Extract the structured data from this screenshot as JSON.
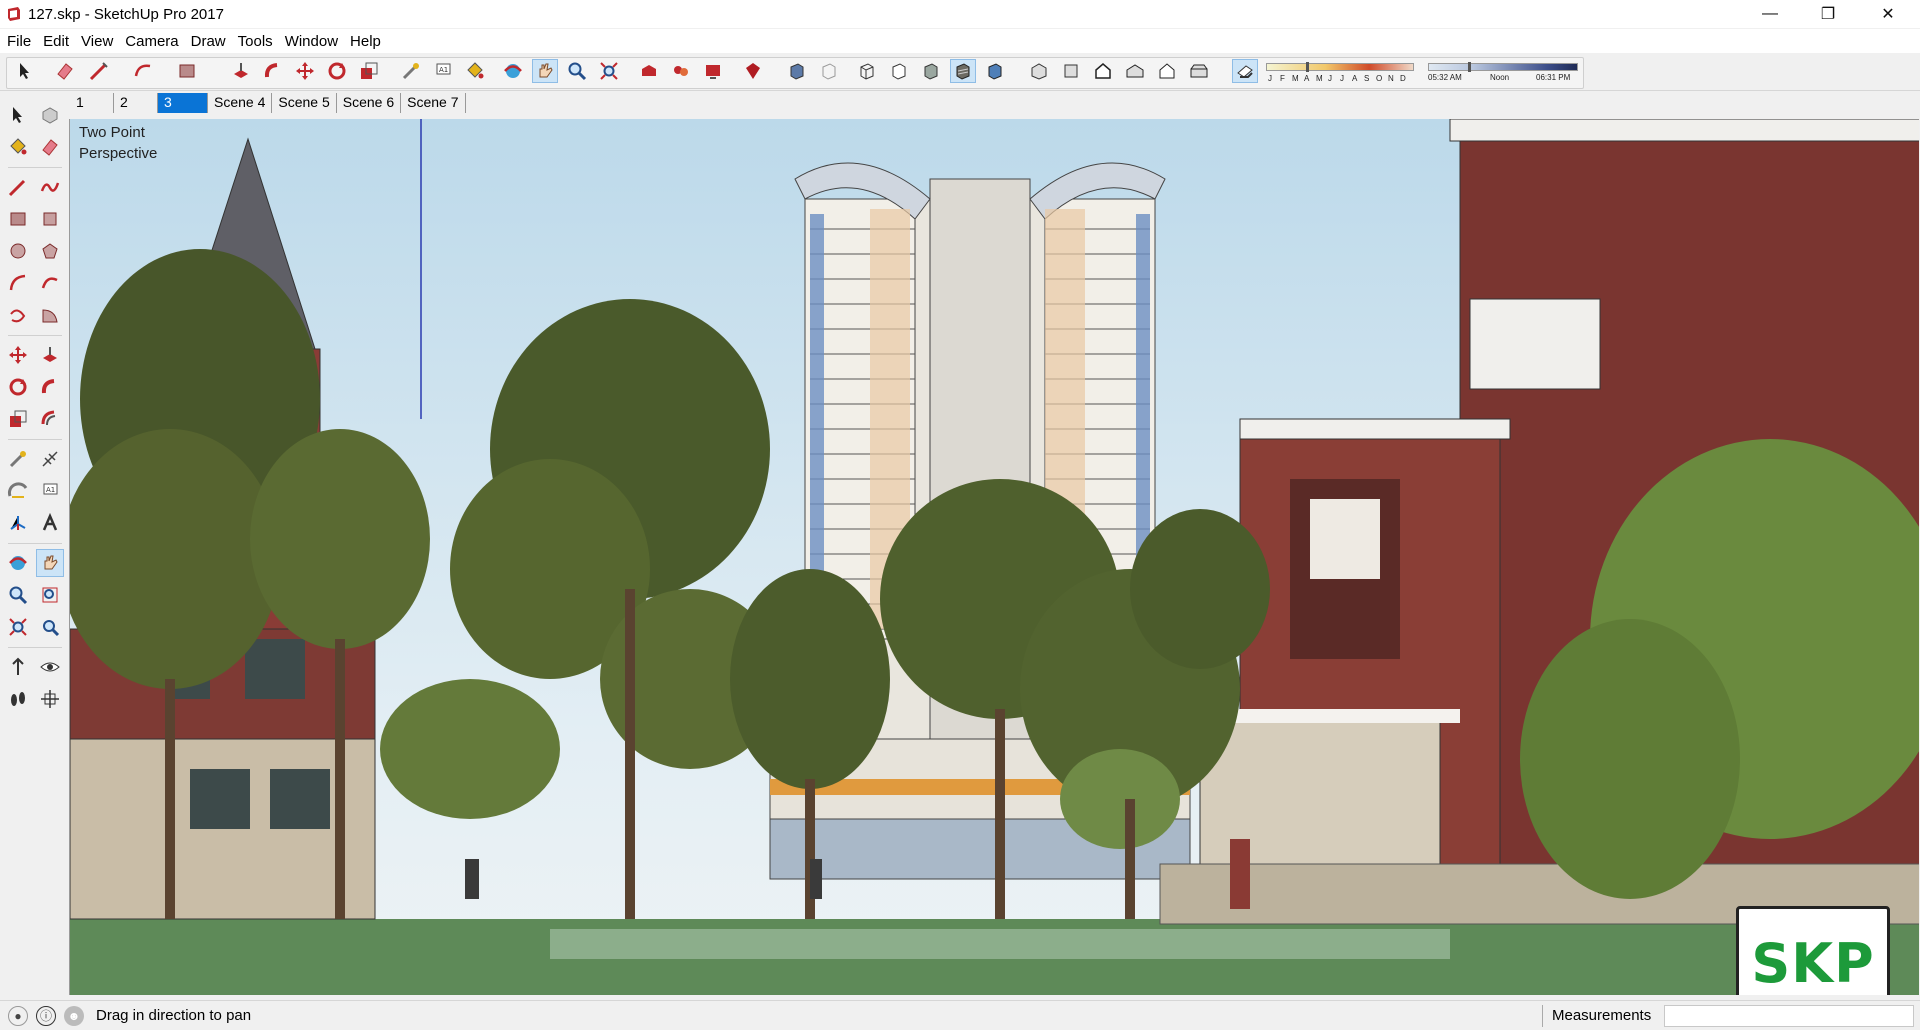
{
  "window": {
    "title": "127.skp - SketchUp Pro 2017",
    "minimize_glyph": "—",
    "maximize_glyph": "❐",
    "close_glyph": "✕"
  },
  "menu": [
    "File",
    "Edit",
    "View",
    "Camera",
    "Draw",
    "Tools",
    "Window",
    "Help"
  ],
  "toolbar": {
    "shadow_months": [
      "J",
      "F",
      "M",
      "A",
      "M",
      "J",
      "J",
      "A",
      "S",
      "O",
      "N",
      "D"
    ],
    "time_start": "05:32 AM",
    "time_mid": "Noon",
    "time_end": "06:31 PM"
  },
  "scenes": {
    "tabs": [
      "1",
      "2",
      "3",
      "Scene 4",
      "Scene 5",
      "Scene 6",
      "Scene 7"
    ],
    "active_index": 2
  },
  "viewport": {
    "label_line1": "Two Point",
    "label_line2": "Perspective",
    "logo_text": "SKP"
  },
  "status": {
    "message": "Drag in direction to pan",
    "measurements_label": "Measurements",
    "measurements_value": ""
  },
  "colors": {
    "accent": "#0a74d6",
    "sketchup_red": "#c0282d",
    "logo_green": "#1d9a3a"
  }
}
